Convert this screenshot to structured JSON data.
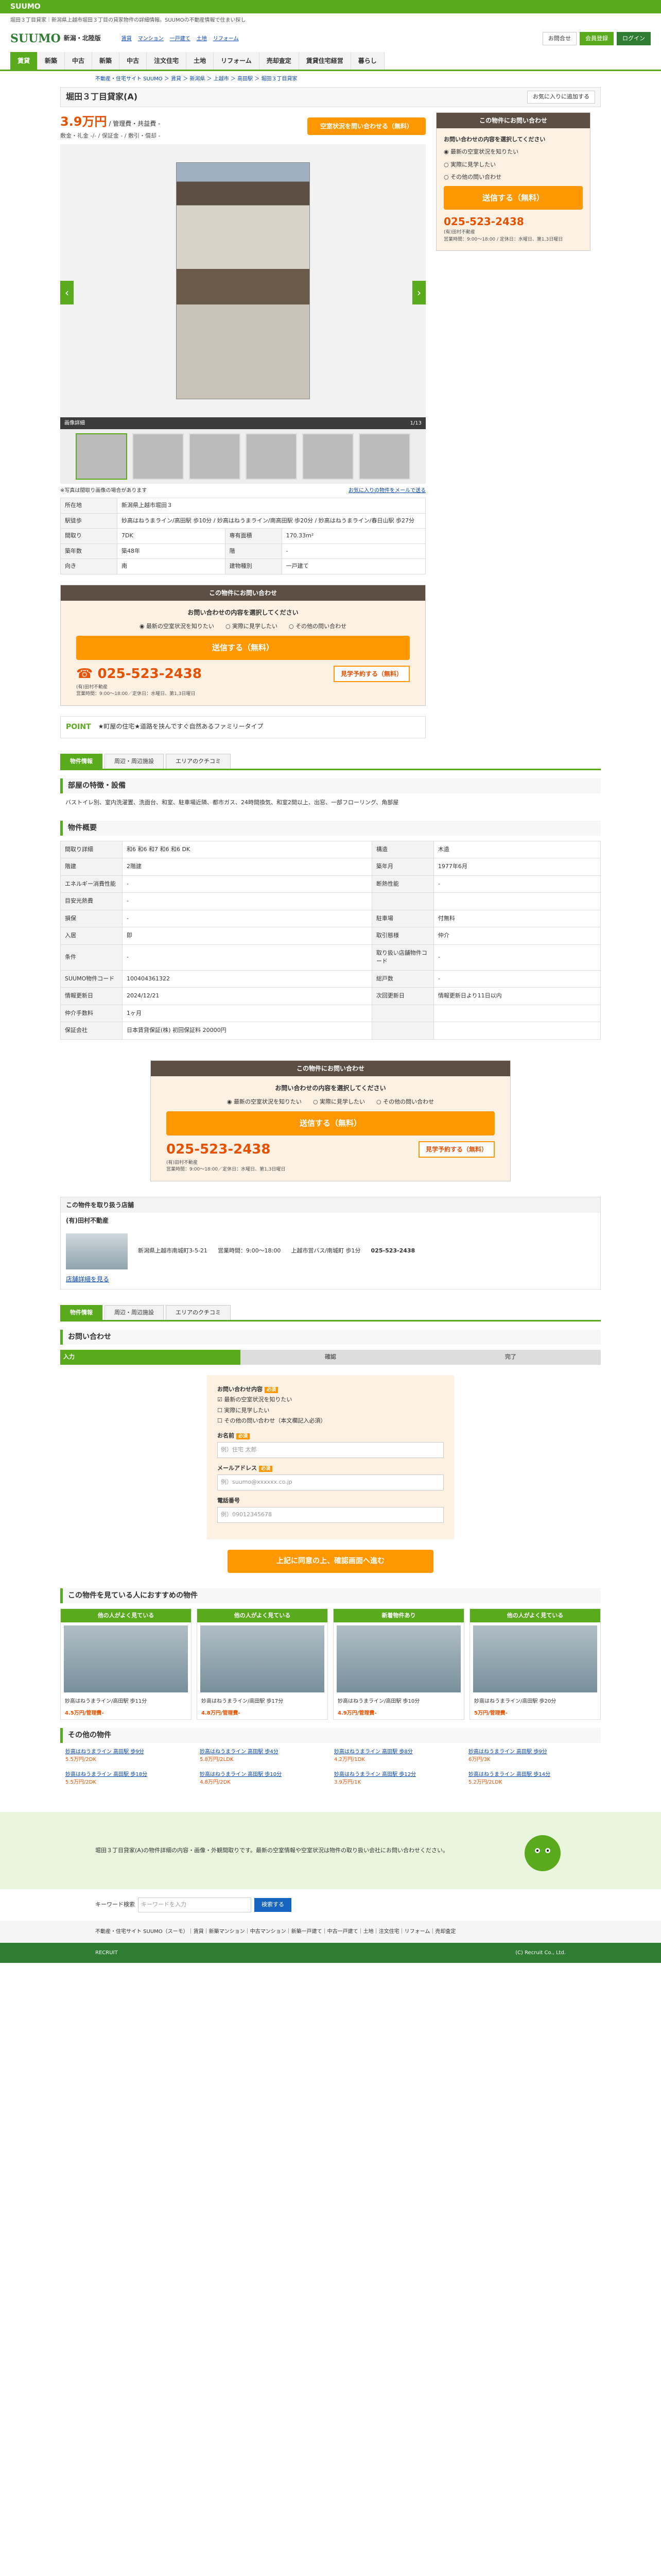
{
  "topbar": {
    "brand": "SUUMO"
  },
  "topnote": "堀田３丁目貸家｜新潟県上越市堀田３丁目の貸家物件の詳細情報。SUUMOの不動産情報で住まい探し",
  "header": {
    "logo": "SUUMO",
    "region": "新潟・北陸版",
    "links": [
      "賃貸",
      "マンション",
      "一戸建て",
      "土地",
      "リフォーム"
    ],
    "btn_inquiry": "お問合せ",
    "btn_member": "会員登録",
    "btn_login": "ログイン"
  },
  "gnav": [
    "賃貸",
    "新築",
    "中古",
    "新築",
    "中古",
    "注文住宅",
    "土地",
    "リフォーム",
    "売却査定",
    "賃貸住宅経営",
    "暮らし"
  ],
  "breadcrumb": "不動産・住宅サイト SUUMO ＞ 賃貸 ＞ 新潟県 ＞ 上越市 ＞ 高田駅 ＞ 堀田３丁目貸家",
  "property": {
    "title": "堀田３丁目貸家(A)",
    "fav_label": "お気に入りに追加する",
    "price": "3.9万円",
    "price_suffix": "/ 管理費・共益費 -",
    "price_sub": "敷金・礼金 -/- / 保証金 - / 敷引・償却 -",
    "cta": "空室状況を問い合わせる（無料）",
    "photo_counter": "1/13",
    "photo_label": "画像詳細",
    "link_left": "※写真は間取り画像の場合があります",
    "link_right": "お気に入りの物件をメールで送る"
  },
  "spec": [
    {
      "k": "所在地",
      "v": "新潟県上越市堀田３"
    },
    {
      "k": "駅徒歩",
      "v": "妙高はねうまライン/高田駅 歩10分 / 妙高はねうまライン/南高田駅 歩20分 / 妙高はねうまライン/春日山駅 歩27分"
    },
    {
      "k": "間取り",
      "v": "7DK",
      "k2": "専有面積",
      "v2": "170.33m²"
    },
    {
      "k": "築年数",
      "v": "築48年",
      "k2": "階",
      "v2": "-"
    },
    {
      "k": "向き",
      "v": "南",
      "k2": "建物種別",
      "v2": "一戸建て"
    }
  ],
  "inquiry": {
    "head": "この物件にお問い合わせ",
    "question": "お問い合わせの内容を選択してください",
    "opt1": "最新の空室状況を知りたい",
    "opt2": "実際に見学したい",
    "opt3": "その他の問い合わせ",
    "submit": "送信する（無料）",
    "phone": "025-523-2438",
    "reserve": "見学予約する（無料）",
    "company": "(有)田村不動産",
    "hours": "営業時間：9:00～18:00／定休日：水曜日、第1,3日曜日"
  },
  "point": {
    "label": "POINT",
    "text": "★町屋の住宅★道路を挟んですぐ自然あるファミリータイプ"
  },
  "side": {
    "head": "この物件にお問い合わせ",
    "question": "お問い合わせの内容を選択してください",
    "opt1": "最新の空室状況を知りたい",
    "opt2": "実際に見学したい",
    "opt3": "その他の問い合わせ",
    "submit": "送信する（無料）",
    "phone": "025-523-2438",
    "company": "(有)田村不動産",
    "hours": "営業時間：9:00～18:00 / 定休日：水曜日、第1,3日曜日"
  },
  "tabs": [
    "物件情報",
    "周辺・周辺施設",
    "エリアのクチコミ"
  ],
  "features": {
    "title": "部屋の特徴・設備",
    "text": "バストイレ別、室内洗濯置、洗面台、和室、駐車場近隣、都市ガス、24時間換気、和室2間以上、出窓、一部フローリング、角部屋"
  },
  "overview": {
    "title": "物件概要",
    "rows": [
      {
        "k": "間取り詳細",
        "v": "和6 和6 和7 和6 和6 DK",
        "k2": "構造",
        "v2": "木造"
      },
      {
        "k": "階建",
        "v": "2階建",
        "k2": "築年月",
        "v2": "1977年6月"
      },
      {
        "k": "エネルギー消費性能",
        "v": "-",
        "k2": "断熱性能",
        "v2": "-"
      },
      {
        "k": "目安光熱費",
        "v": "-",
        "k2": "",
        "v2": ""
      },
      {
        "k": "損保",
        "v": "-",
        "k2": "駐車場",
        "v2": "付無料"
      },
      {
        "k": "入居",
        "v": "即",
        "k2": "取引態様",
        "v2": "仲介"
      },
      {
        "k": "条件",
        "v": "-",
        "k2": "取り扱い店舗物件コード",
        "v2": "-"
      },
      {
        "k": "SUUMO物件コード",
        "v": "100404361322",
        "k2": "総戸数",
        "v2": "-"
      },
      {
        "k": "情報更新日",
        "v": "2024/12/21",
        "k2": "次回更新日",
        "v2": "情報更新日より11日以内"
      },
      {
        "k": "仲介手数料",
        "v": "1ヶ月",
        "k2": "",
        "v2": ""
      },
      {
        "k": "保証会社",
        "v": "日本賃貸保証(株) 初回保証料 20000円",
        "k2": "",
        "v2": ""
      }
    ]
  },
  "company_sec": {
    "title": "この物件を取り扱う店舗",
    "name": "(有)田村不動産",
    "address": "新潟県上越市南城町3-5-21",
    "hours": "営業時間：9:00～18:00",
    "access": "上越市営バス/南城町 歩1分",
    "phone": "025-523-2438",
    "link": "店舗詳細を見る"
  },
  "form": {
    "title": "お問い合わせ",
    "step1": "入力",
    "step2": "確認",
    "step3": "完了",
    "content_label": "お問い合わせ内容",
    "req": "必須",
    "opt1": "最新の空室状況を知りたい",
    "opt2": "実際に見学したい",
    "opt3": "その他の問い合わせ（本文欄記入必須）",
    "name_label": "お名前",
    "name_ph": "例）住宅 太郎",
    "mail_label": "メールアドレス",
    "mail_ph": "例）suumo@xxxxxx.co.jp",
    "tel_label": "電話番号",
    "tel_ph": "例）09012345678",
    "submit": "上記に同意の上、確認画面へ進む"
  },
  "recommend": {
    "title": "この物件を見ている人におすすめの物件",
    "cards": [
      {
        "head": "他の人がよく見ている",
        "name": "妙高はねうまライン/高田駅 歩11分",
        "price": "4.5万円/管理費-"
      },
      {
        "head": "他の人がよく見ている",
        "name": "妙高はねうまライン/高田駅 歩17分",
        "price": "4.8万円/管理費-"
      },
      {
        "head": "新着物件あり",
        "name": "妙高はねうまライン/高田駅 歩10分",
        "price": "4.9万円/管理費-"
      },
      {
        "head": "他の人がよく見ている",
        "name": "妙高はねうまライン/高田駅 歩20分",
        "price": "5万円/管理費-"
      }
    ]
  },
  "others": {
    "title": "その他の物件",
    "items": [
      {
        "name": "妙高はねうまライン 高田駅 歩9分",
        "price": "5.5万円/2DK"
      },
      {
        "name": "妙高はねうまライン 高田駅 歩4分",
        "price": "5.8万円/2LDK"
      },
      {
        "name": "妙高はねうまライン 高田駅 歩8分",
        "price": "4.2万円/1DK"
      },
      {
        "name": "妙高はねうまライン 高田駅 歩9分",
        "price": "6万円/3K"
      },
      {
        "name": "妙高はねうまライン 高田駅 歩18分",
        "price": "5.5万円/2DK"
      },
      {
        "name": "妙高はねうまライン 高田駅 歩10分",
        "price": "4.8万円/2DK"
      },
      {
        "name": "妙高はねうまライン 高田駅 歩12分",
        "price": "3.9万円/1K"
      },
      {
        "name": "妙高はねうまライン 高田駅 歩14分",
        "price": "5.2万円/2LDK"
      }
    ]
  },
  "footer": {
    "text": "堀田３丁目貸家(A)の物件詳細の内容・画像・外観間取りです。最新の空室情報や空室状況は物件の取り扱い会社にお問い合わせください。",
    "search_label": "キーワード検索",
    "search_ph": "キーワードを入力",
    "search_btn": "検索する",
    "links": "不動産・住宅サイト SUUMO（スーモ）｜賃貸｜新築マンション｜中古マンション｜新築一戸建て｜中古一戸建て｜土地｜注文住宅｜リフォーム｜売却査定",
    "company": "RECRUIT",
    "copyright": "(C) Recruit Co., Ltd."
  }
}
